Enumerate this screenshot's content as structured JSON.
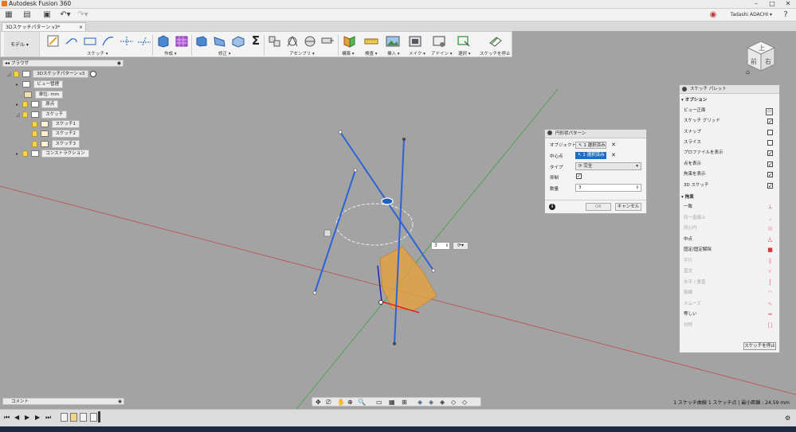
{
  "app_title": "Autodesk Fusion 360",
  "document_tab": "3Dスケッチパターン v3*",
  "user_name": "Tadashi ADACHI ▾",
  "toolbar": {
    "workspace": "モデル ▾",
    "groups": [
      "スケッチ ▾",
      "作成 ▾",
      "修正 ▾",
      "アセンブリ ▾",
      "構築 ▾",
      "検査 ▾",
      "挿入 ▾",
      "メイク ▾",
      "アドイン ▾",
      "選択 ▾",
      "スケッチを停止"
    ]
  },
  "browser": {
    "title": "ブラウザ",
    "root": "3Dスケッチパターン v3",
    "nodes": [
      "ビュー管理",
      "単位: mm",
      "原点",
      "スケッチ",
      "スケッチ1",
      "スケッチ2",
      "スケッチ3",
      "コンストラクション"
    ]
  },
  "dialog": {
    "title": "円形状パターン",
    "object_label": "オブジェクト",
    "object_value": "1 選択済み",
    "center_label": "中心点",
    "center_value": "1 選択済み",
    "type_label": "タイプ",
    "type_value": "完全",
    "suppress_label": "抑制",
    "count_label": "数量",
    "count_value": "3",
    "ok": "OK",
    "cancel": "キャンセル",
    "info": "i"
  },
  "canvas": {
    "count_input": "3"
  },
  "palette": {
    "title": "スケッチ パレット",
    "options_header": "オプション",
    "options": [
      {
        "label": "ビュー正面",
        "icon": "view-front-icon"
      },
      {
        "label": "スケッチ グリッド",
        "checked": true
      },
      {
        "label": "スナップ",
        "checked": false
      },
      {
        "label": "スライス",
        "checked": false
      },
      {
        "label": "プロファイルを表示",
        "checked": true
      },
      {
        "label": "点を表示",
        "checked": true
      },
      {
        "label": "拘束を表示",
        "checked": true
      },
      {
        "label": "3D スケッチ",
        "checked": true
      }
    ],
    "constraints_header": "拘束",
    "constraints": [
      {
        "label": "一致",
        "enabled": true,
        "glyph": "⊥",
        "color": "#d33"
      },
      {
        "label": "同一直線上",
        "enabled": false,
        "glyph": "⌟",
        "color": "#e7a"
      },
      {
        "label": "同心円",
        "enabled": false,
        "glyph": "◎",
        "color": "#e7a"
      },
      {
        "label": "中点",
        "enabled": true,
        "glyph": "△",
        "color": "#d33"
      },
      {
        "label": "固定/固定解除",
        "enabled": true,
        "glyph": "🔒",
        "color": "#d33"
      },
      {
        "label": "平行",
        "enabled": false,
        "glyph": "∥",
        "color": "#e7a"
      },
      {
        "label": "直交",
        "enabled": false,
        "glyph": "√",
        "color": "#e7a"
      },
      {
        "label": "水平 / 垂直",
        "enabled": false,
        "glyph": "┇",
        "color": "#e7a"
      },
      {
        "label": "接線",
        "enabled": false,
        "glyph": "◠",
        "color": "#e7a"
      },
      {
        "label": "スムーズ",
        "enabled": false,
        "glyph": "∿",
        "color": "#e7a"
      },
      {
        "label": "等しい",
        "enabled": true,
        "glyph": "═",
        "color": "#d33"
      },
      {
        "label": "対称",
        "enabled": false,
        "glyph": "[]",
        "color": "#e7a"
      }
    ],
    "stop_button": "スケッチを停止"
  },
  "comment_label": "コメント",
  "status_text": "1 スケッチ曲線 1 スケッチ点 | 最小距離 : 24.59 mm",
  "viewcube": {
    "top": "上",
    "front": "前",
    "right": "右"
  }
}
